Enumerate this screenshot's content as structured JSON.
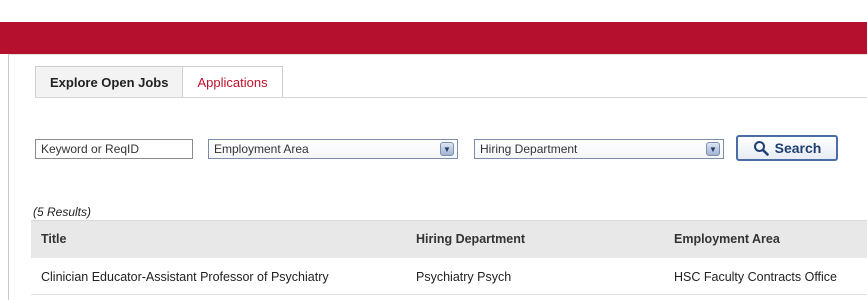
{
  "tabs": [
    {
      "label": "Explore Open Jobs",
      "active": true
    },
    {
      "label": "Applications",
      "active": false
    }
  ],
  "search": {
    "keyword_placeholder": "Keyword or ReqID",
    "employment_area_value": "Employment Area",
    "hiring_department_value": "Hiring Department",
    "search_label": "Search"
  },
  "results": {
    "count_label": "(5 Results)",
    "columns": [
      "Title",
      "Hiring Department",
      "Employment Area"
    ],
    "rows": [
      {
        "title": "Clinician Educator-Assistant Professor of Psychiatry",
        "hiring_department": "Psychiatry Psych",
        "employment_area": "HSC Faculty Contracts Office"
      }
    ]
  },
  "colors": {
    "brand_red": "#b5102e",
    "link_red": "#c0102a",
    "button_blue": "#1f3f74"
  }
}
